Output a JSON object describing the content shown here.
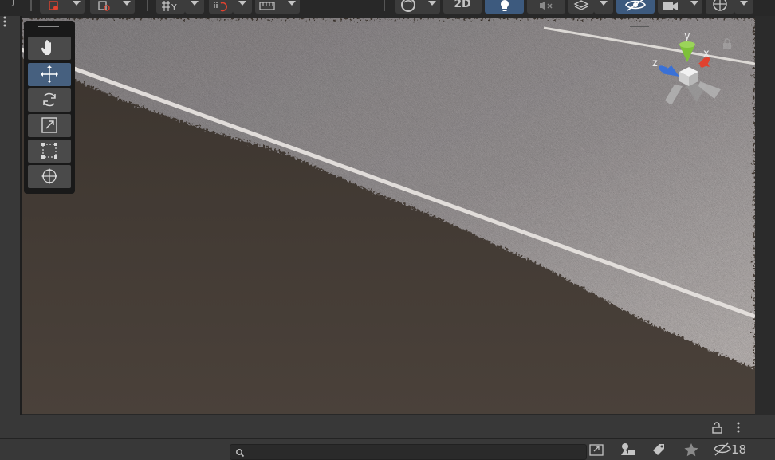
{
  "toolbar": {
    "label_2d": "2D",
    "icons": [
      "gizmo-transform-icon",
      "pivot-icon",
      "grid-snap-icon",
      "increment-snap-icon",
      "ruler-icon",
      "draw-mode-icon",
      "2d-toggle",
      "lighting-icon",
      "audio-mute-icon",
      "layers-icon",
      "scene-visibility-icon",
      "camera-icon",
      "gizmos-icon"
    ],
    "active": [
      "lighting",
      "scene-visibility"
    ]
  },
  "tools": {
    "items": [
      "hand",
      "move",
      "rotate",
      "scale",
      "rect",
      "transform"
    ],
    "active": "move"
  },
  "gizmo": {
    "x_label": "x",
    "y_label": "y",
    "z_label": "z"
  },
  "colors": {
    "active": "#3d5a7e",
    "x_axis": "#e0422f",
    "y_axis": "#7ec13a",
    "z_axis": "#3a71d6",
    "panel": "#383838"
  },
  "bottom": {
    "search_value": "",
    "hidden_count": "18"
  }
}
